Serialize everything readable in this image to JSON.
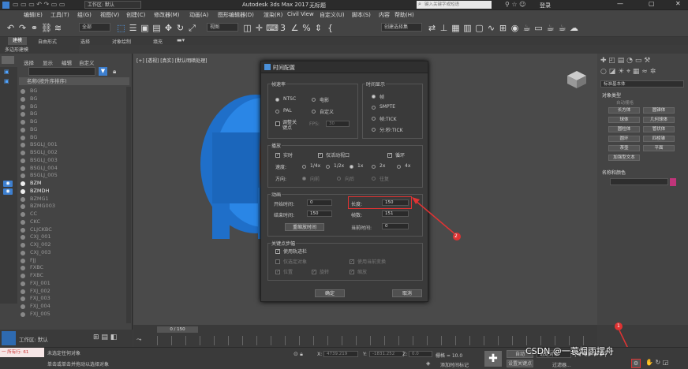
{
  "app": {
    "title": "Autodesk 3ds Max 2017",
    "filename": "无标题",
    "workspace": "工作区: 默认",
    "search_placeholder": "键入关键字或短语",
    "login": "登录"
  },
  "menu": [
    "编辑(E)",
    "工具(T)",
    "组(G)",
    "视图(V)",
    "创建(C)",
    "修改器(M)",
    "动画(A)",
    "图形编辑器(D)",
    "渲染(R)",
    "Civil View",
    "自定义(U)",
    "脚本(S)",
    "内容",
    "帮助(H)"
  ],
  "toolbar": {
    "filter": "全部",
    "view": "视图",
    "selset": "创建选择集"
  },
  "ribbon": {
    "tabs": [
      "建模",
      "自由形式",
      "选择",
      "对象绘制",
      "填充"
    ],
    "sub": "多边形建模"
  },
  "scene_explorer": {
    "tabs": [
      "选择",
      "显示",
      "编辑",
      "自定义"
    ],
    "header": "名称(按升序排序)",
    "items": [
      {
        "name": "BG",
        "visible": false
      },
      {
        "name": "BG",
        "visible": false
      },
      {
        "name": "BG",
        "visible": false
      },
      {
        "name": "BG",
        "visible": false
      },
      {
        "name": "BG",
        "visible": false
      },
      {
        "name": "BG",
        "visible": false
      },
      {
        "name": "BG",
        "visible": false
      },
      {
        "name": "BSGLJ_001",
        "visible": false
      },
      {
        "name": "BSGLJ_002",
        "visible": false
      },
      {
        "name": "BSGLJ_003",
        "visible": false
      },
      {
        "name": "BSGLJ_004",
        "visible": false
      },
      {
        "name": "BSGLJ_005",
        "visible": false
      },
      {
        "name": "BZM",
        "visible": true
      },
      {
        "name": "BZMDH",
        "visible": true
      },
      {
        "name": "BZMG1",
        "visible": false
      },
      {
        "name": "BZMG003",
        "visible": false
      },
      {
        "name": "CC",
        "visible": false
      },
      {
        "name": "CKC",
        "visible": false
      },
      {
        "name": "CLJCKBC",
        "visible": false
      },
      {
        "name": "CXJ_001",
        "visible": false
      },
      {
        "name": "CXJ_002",
        "visible": false
      },
      {
        "name": "CXJ_003",
        "visible": false
      },
      {
        "name": "FJJ",
        "visible": false
      },
      {
        "name": "FXBC",
        "visible": false
      },
      {
        "name": "FXBC",
        "visible": false
      },
      {
        "name": "FXJ_001",
        "visible": false
      },
      {
        "name": "FXJ_002",
        "visible": false
      },
      {
        "name": "FXJ_003",
        "visible": false
      },
      {
        "name": "FXJ_004",
        "visible": false
      },
      {
        "name": "FXJ_005",
        "visible": false
      }
    ],
    "workspace": "工作区: 默认"
  },
  "viewport": {
    "label": "[+] [透视] [真实] [默认明暗处理]"
  },
  "dialog": {
    "title": "时间配置",
    "framerate": {
      "label": "帧速率",
      "options": [
        "NTSC",
        "电影",
        "PAL",
        "自定义"
      ],
      "adjust_label": "调整关键点",
      "fps_label": "FPS:",
      "fps_value": "30"
    },
    "timedisplay": {
      "label": "时间显示",
      "options": [
        "帧",
        "SMPTE",
        "帧:TICK",
        "分:秒:TICK"
      ]
    },
    "playback": {
      "label": "播放",
      "realtime": "实时",
      "active_only": "仅活动视口",
      "loop": "循环",
      "speed_label": "速度:",
      "speeds": [
        "1/4x",
        "1/2x",
        "1x",
        "2x",
        "4x"
      ],
      "direction_label": "方向:",
      "directions": [
        "向前",
        "向后",
        "往复"
      ]
    },
    "animation": {
      "label": "动画",
      "start_label": "开始时间:",
      "start_value": "0",
      "end_label": "结束时间:",
      "end_value": "150",
      "length_label": "长度:",
      "length_value": "150",
      "framecount_label": "帧数:",
      "framecount_value": "151",
      "rescale_label": "重缩放时间",
      "current_label": "当前时间:",
      "current_value": "0"
    },
    "keysteps": {
      "label": "关键点步幅",
      "use_tracks": "使用轨迹栏",
      "selected_only": "仅选定对象",
      "use_transform": "使用当前变换",
      "position": "位置",
      "rotation": "旋转",
      "scale": "缩放"
    },
    "ok": "确定",
    "cancel": "取消"
  },
  "annotations": {
    "marker1": "1",
    "marker2": "2"
  },
  "command_panel": {
    "dropdown": "标准基本体",
    "object_type": "对象类型",
    "autogrid": "自动栅格",
    "buttons": [
      "长方体",
      "圆锥体",
      "球体",
      "几何球体",
      "圆柱体",
      "管状体",
      "圆环",
      "四棱锥",
      "茶壶",
      "平面",
      "加强型文本"
    ],
    "name_color": "名称和颜色",
    "accent": "#c0357a"
  },
  "timeline": {
    "frame": "0 / 150"
  },
  "status": {
    "none_selected": "未选定任何对象",
    "hint": "单击或单击并拖动以选择对象",
    "maxscript": "一 所有行: 61",
    "x_label": "X:",
    "x": "4739.219",
    "y_label": "Y:",
    "y": "-1831.252",
    "z_label": "Z:",
    "z": "0.0",
    "grid": "栅格 = 10.0",
    "addtimetag": "添加时间标记",
    "autokey": "自动",
    "setkey": "设置关键点",
    "selected": "选定对象",
    "filter": "过滤器..."
  },
  "watermark": "CSDN @一蓑烟雨摆舟"
}
